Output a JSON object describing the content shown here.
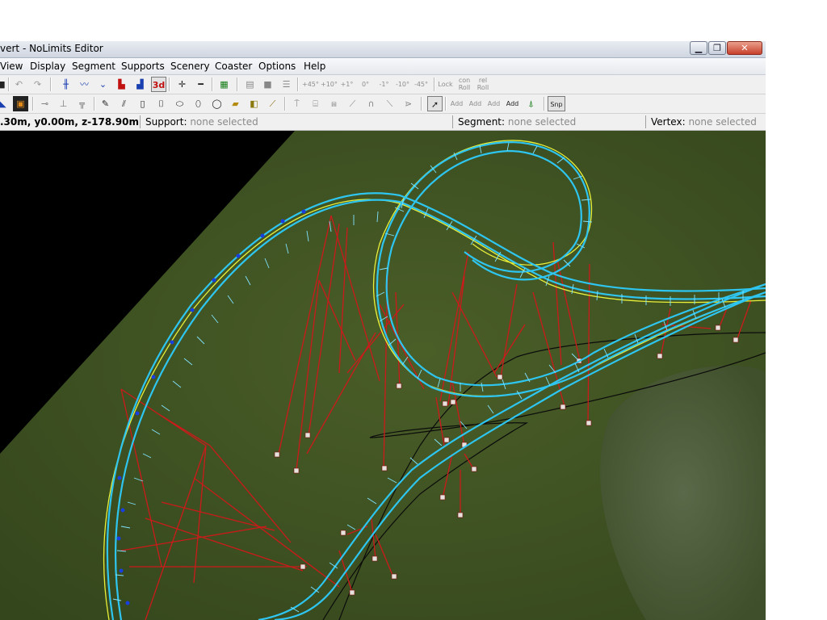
{
  "window": {
    "title": "vert - NoLimits Editor",
    "minimize_glyph": "▁",
    "maximize_glyph": "❐",
    "close_glyph": "✕"
  },
  "menu": [
    "View",
    "Display",
    "Segment",
    "Supports",
    "Scenery",
    "Coaster",
    "Options",
    "Help"
  ],
  "toolbar1": {
    "tool_3d": "3d",
    "angle_buttons": [
      "+45°",
      "+10°",
      "+1°",
      "0°",
      "-1°",
      "-10°",
      "-45°"
    ],
    "lock_roll": "Lock",
    "con_roll": "con Roll",
    "rel_roll": "rel Roll"
  },
  "toolbar2": {
    "add_buttons": [
      "Add",
      "Add",
      "Add",
      "Add"
    ],
    "snap_label": "Snp"
  },
  "status": {
    "coords": ".30m, y0.00m, z-178.90m",
    "support_label": "Support:",
    "support_value": "none selected",
    "segment_label": "Segment:",
    "segment_value": "none selected",
    "vertex_label": "Vertex:",
    "vertex_value": "none selected"
  },
  "colors": {
    "ground": "#3d4f21",
    "track": "#2ec6f0",
    "track_outline": "#e8f03a",
    "supports": "#cc1a1a",
    "sky": "#000000"
  }
}
